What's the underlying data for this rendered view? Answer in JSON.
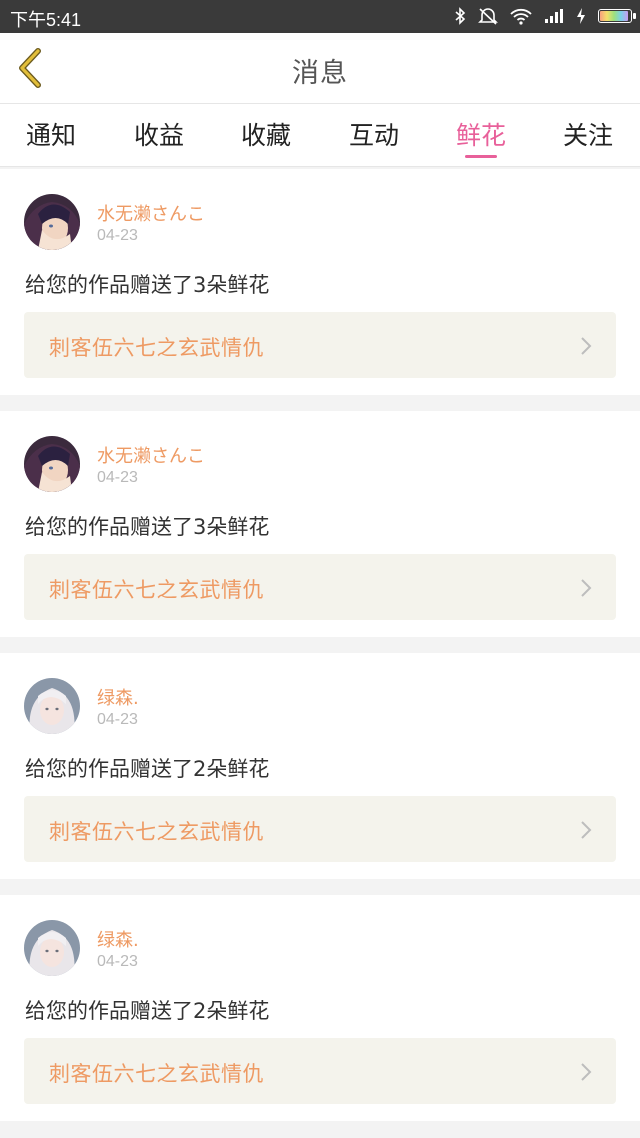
{
  "status_bar": {
    "time": "下午5:41",
    "icons": [
      "bluetooth-icon",
      "mute-icon",
      "wifi-icon",
      "signal-icon",
      "charging-icon",
      "battery-icon"
    ]
  },
  "header": {
    "title": "消息",
    "back_icon": "chevron-left-icon"
  },
  "tabs": [
    {
      "label": "通知",
      "active": false
    },
    {
      "label": "收益",
      "active": false
    },
    {
      "label": "收藏",
      "active": false
    },
    {
      "label": "互动",
      "active": false
    },
    {
      "label": "鲜花",
      "active": true
    },
    {
      "label": "关注",
      "active": false
    }
  ],
  "messages": [
    {
      "user": "水无濑さんこ",
      "date": "04-23",
      "text": "给您的作品赠送了3朵鲜花",
      "work_title": "刺客伍六七之玄武情仇"
    },
    {
      "user": "水无濑さんこ",
      "date": "04-23",
      "text": "给您的作品赠送了3朵鲜花",
      "work_title": "刺客伍六七之玄武情仇"
    },
    {
      "user": "绿森.",
      "date": "04-23",
      "text": "给您的作品赠送了2朵鲜花",
      "work_title": "刺客伍六七之玄武情仇"
    },
    {
      "user": "绿森.",
      "date": "04-23",
      "text": "给您的作品赠送了2朵鲜花",
      "work_title": "刺客伍六七之玄武情仇"
    }
  ],
  "colors": {
    "accent": "#e8609a",
    "username": "#ee9a63",
    "back_icon": "#c9a227"
  }
}
